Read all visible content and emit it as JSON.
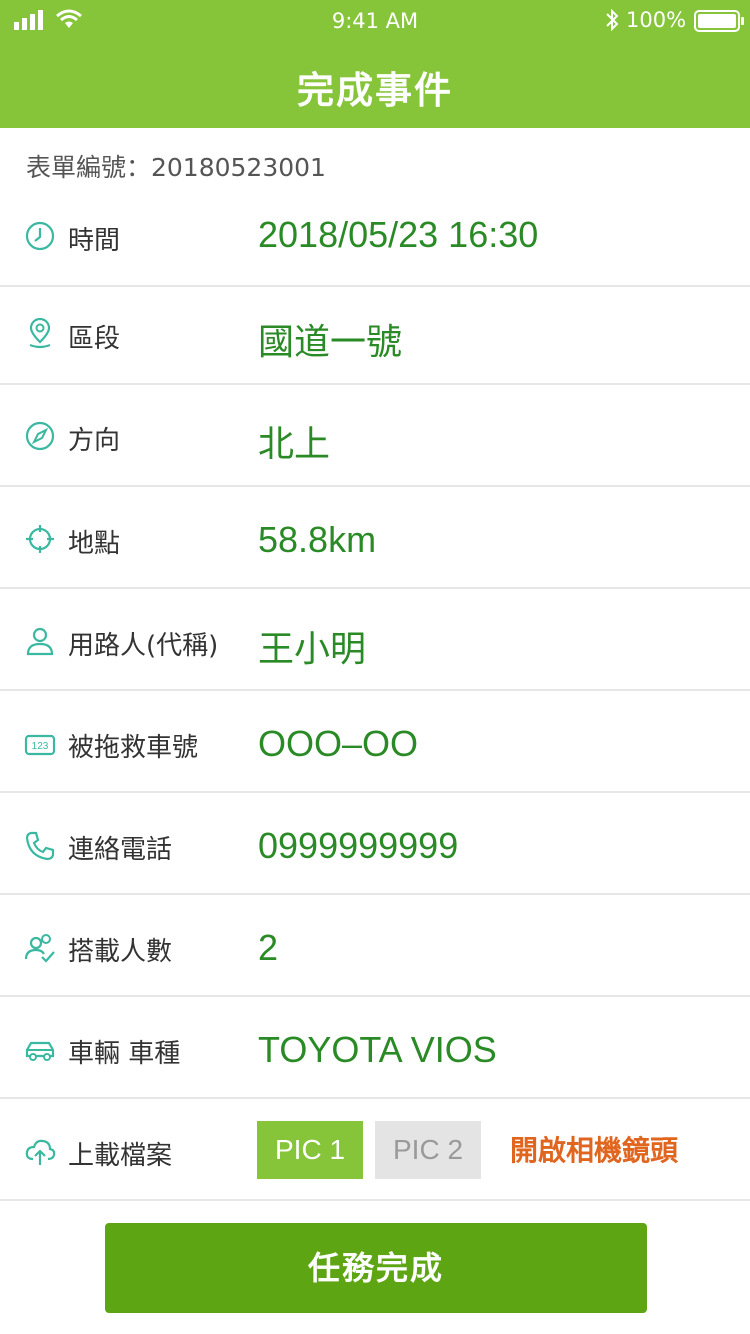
{
  "status_bar": {
    "time": "9:41 AM",
    "battery_percent": "100%"
  },
  "header": {
    "title": "完成事件"
  },
  "form": {
    "number_label": "表單編號：20180523001"
  },
  "rows": [
    {
      "icon": "clock-icon",
      "label": "時間",
      "value": "2018/05/23 16:30"
    },
    {
      "icon": "location-pin-icon",
      "label": "區段",
      "value": "國道一號"
    },
    {
      "icon": "compass-icon",
      "label": "方向",
      "value": "北上"
    },
    {
      "icon": "crosshair-icon",
      "label": "地點",
      "value": "58.8km"
    },
    {
      "icon": "user-icon",
      "label": "用路人(代稱)",
      "value": "王小明"
    },
    {
      "icon": "plate-123-icon",
      "label": "被拖救車號",
      "value": "OOO–OO"
    },
    {
      "icon": "phone-icon",
      "label": "連絡電話",
      "value": "0999999999"
    },
    {
      "icon": "people-icon",
      "label": "搭載人數",
      "value": "2"
    },
    {
      "icon": "car-icon",
      "label": "車輛 車種",
      "value": "TOYOTA VIOS"
    }
  ],
  "upload": {
    "icon": "cloud-upload-icon",
    "label": "上載檔案",
    "pic1": "PIC 1",
    "pic2": "PIC 2",
    "camera": "開啟相機鏡頭"
  },
  "submit_button": "任務完成",
  "colors": {
    "header": "#86c43a",
    "value_text": "#2a8a26",
    "icon": "#3bb8a0",
    "camera_link": "#e0651f",
    "button": "#5ea513"
  }
}
